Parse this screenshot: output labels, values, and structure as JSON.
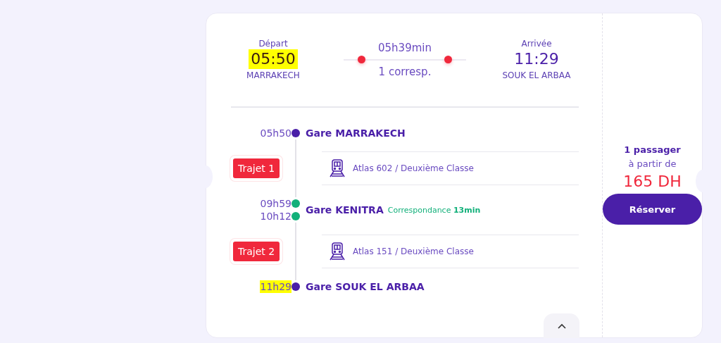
{
  "summary": {
    "departure": {
      "label": "Départ",
      "time": "05:50",
      "station": "MARRAKECH",
      "highlighted": true
    },
    "duration": "05h39min",
    "connections": "1 corresp.",
    "arrival": {
      "label": "Arrivée",
      "time": "11:29",
      "station": "SOUK EL ARBAA",
      "highlighted": false
    }
  },
  "timeline": [
    {
      "kind": "stop",
      "times": [
        {
          "time": "05h50",
          "highlighted": false
        }
      ],
      "name": "Gare MARRAKECH",
      "color": "#4a1fa8"
    },
    {
      "kind": "segment",
      "badge": "Trajet 1",
      "train": "Atlas 602 / Deuxième Classe"
    },
    {
      "kind": "stop",
      "times": [
        {
          "time": "09h59",
          "highlighted": false
        },
        {
          "time": "10h12",
          "highlighted": false
        }
      ],
      "name": "Gare KENITRA",
      "color": "#12b07a",
      "connection": {
        "label": "Correspondance",
        "duration": "13min"
      }
    },
    {
      "kind": "segment",
      "badge": "Trajet 2",
      "train": "Atlas 151 / Deuxième Classe"
    },
    {
      "kind": "stop",
      "times": [
        {
          "time": "11h29",
          "highlighted": true
        }
      ],
      "name": "Gare SOUK EL ARBAA",
      "color": "#4a1fa8"
    }
  ],
  "offer": {
    "passengers": "1 passager",
    "from": "à partir de",
    "price": "165 DH",
    "button": "Réserver"
  }
}
